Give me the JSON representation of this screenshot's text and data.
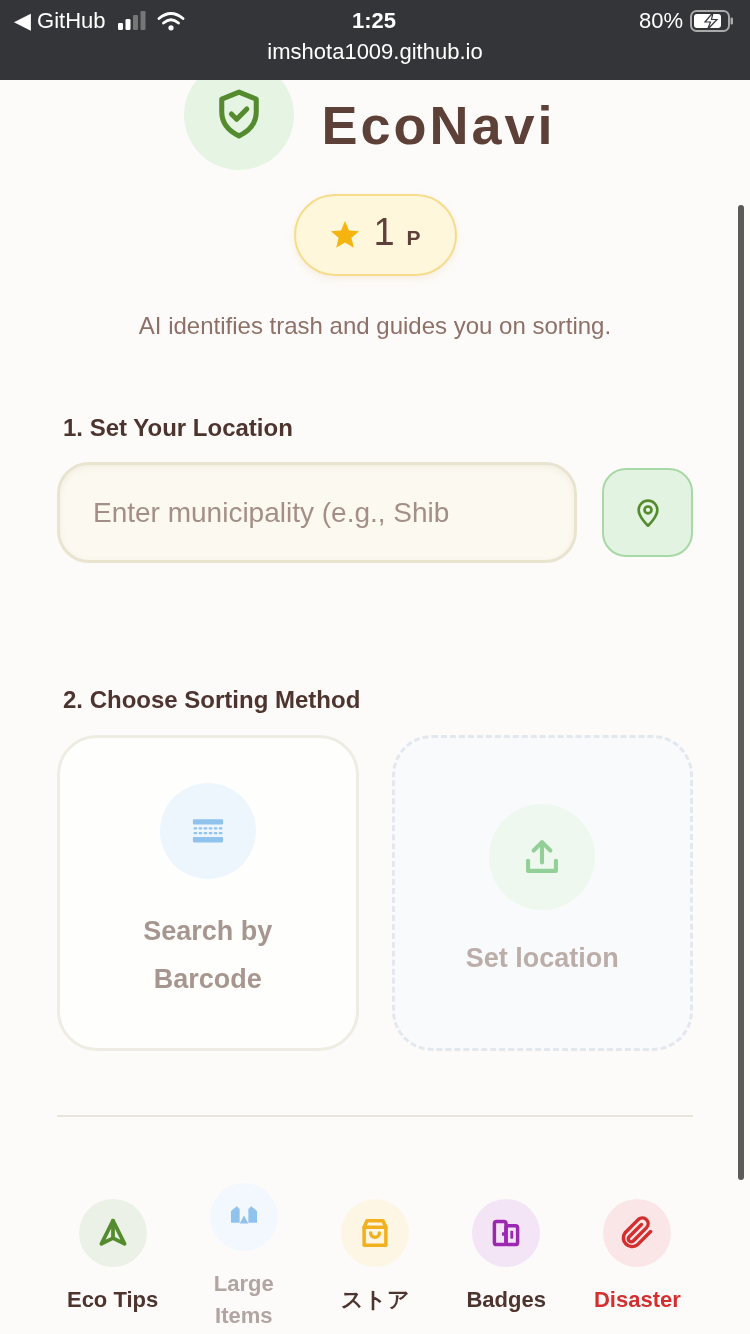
{
  "status_bar": {
    "back_glyph": "◀",
    "back_app": "GitHub",
    "time": "1:25",
    "battery": "80%",
    "url": "imshota1009.github.io"
  },
  "header": {
    "title": "EcoNavi",
    "points": {
      "value": "1",
      "unit": "P"
    },
    "subtitle": "AI identifies trash and guides you on sorting."
  },
  "location": {
    "heading": "1. Set Your Location",
    "input": {
      "placeholder": "Enter municipality (e.g., Shib"
    }
  },
  "sorting": {
    "heading": "2. Choose Sorting Method",
    "methods": [
      {
        "kind": "barcode",
        "label": "Search by Barcode",
        "disabled": false
      },
      {
        "kind": "upload",
        "label": "Set location",
        "disabled": true
      }
    ]
  },
  "bottom_nav": [
    {
      "kind": "tips",
      "label": "Eco Tips",
      "color": "#558b2f",
      "disabled": false,
      "alert": false
    },
    {
      "kind": "large",
      "label": "Large Items",
      "color": "#90c2ee",
      "disabled": true,
      "alert": false
    },
    {
      "kind": "store",
      "label": "ストア",
      "color": "#f2b01e",
      "disabled": false,
      "alert": false
    },
    {
      "kind": "badges",
      "label": "Badges",
      "color": "#9c27b0",
      "disabled": false,
      "alert": false
    },
    {
      "kind": "disaster",
      "label": "Disaster",
      "color": "#d32f2f",
      "disabled": false,
      "alert": true
    }
  ]
}
